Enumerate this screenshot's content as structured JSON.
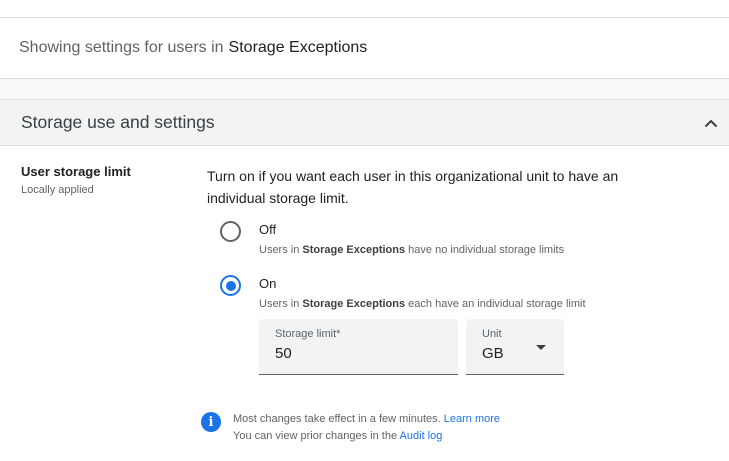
{
  "context": {
    "prefix": "Showing settings for users in",
    "org_unit": "Storage Exceptions"
  },
  "section": {
    "title": "Storage use and settings",
    "collapse_icon": "chevron-up-icon"
  },
  "setting": {
    "name": "User storage limit",
    "status": "Locally applied",
    "description": "Turn on if you want each user in this organizational unit to have an individual storage limit."
  },
  "options": {
    "off": {
      "label": "Off",
      "sub_prefix": "Users in",
      "sub_ou": "Storage Exceptions",
      "sub_suffix": "have no individual storage limits",
      "checked": false
    },
    "on": {
      "label": "On",
      "sub_prefix": "Users in",
      "sub_ou": "Storage Exceptions",
      "sub_suffix": "each have an individual storage limit",
      "checked": true
    }
  },
  "storage_limit": {
    "label": "Storage limit*",
    "value": "50"
  },
  "unit": {
    "label": "Unit",
    "value": "GB"
  },
  "info": {
    "icon": "info-icon",
    "line1": "Most changes take effect in a few minutes.",
    "learn_more": "Learn more",
    "line2": "You can view prior changes in the",
    "audit_log": "Audit log"
  },
  "colors": {
    "accent": "#1a73e8",
    "header_bg": "#f1f3f4"
  }
}
